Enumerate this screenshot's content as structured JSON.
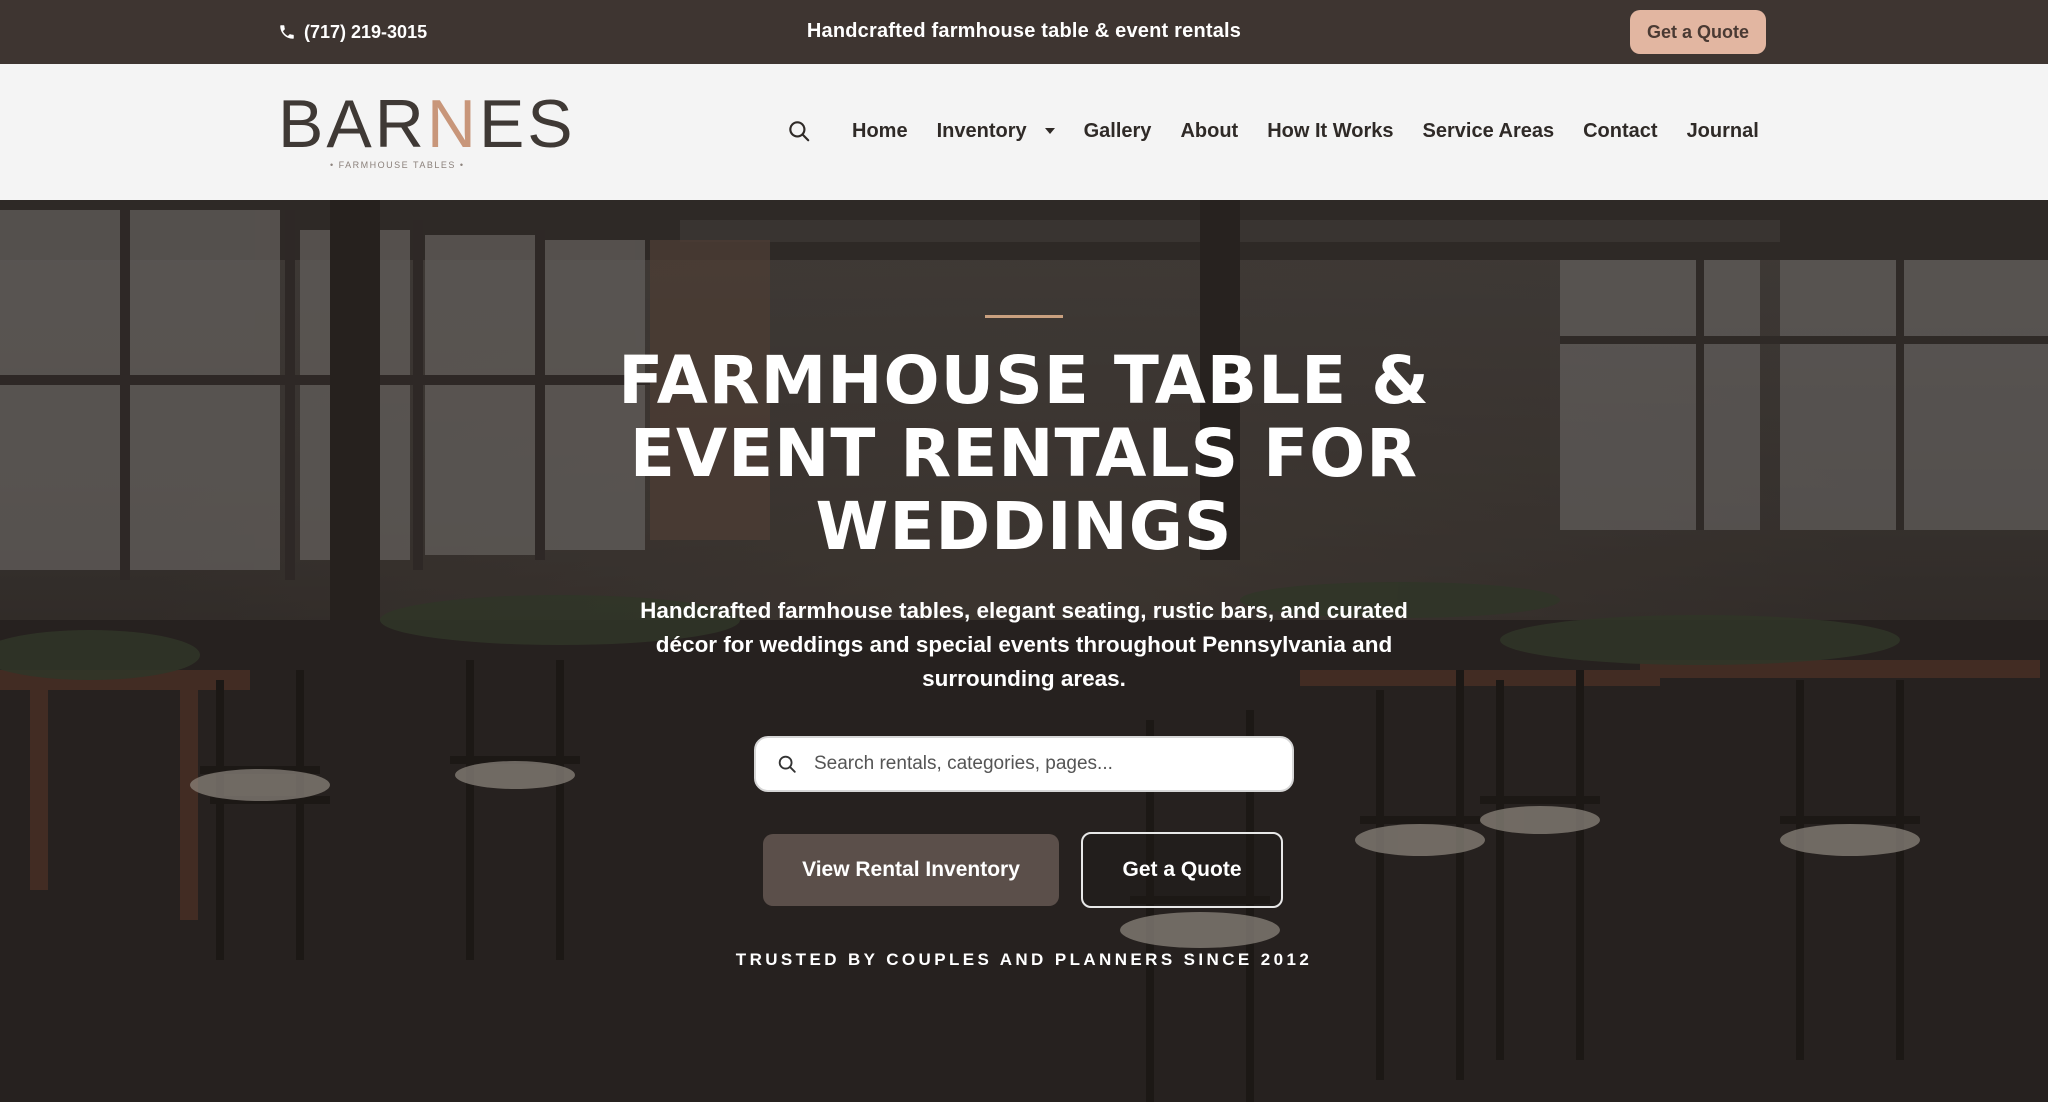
{
  "topbar": {
    "phone": "(717) 219-3015",
    "tagline": "Handcrafted farmhouse table & event rentals",
    "quote_button": "Get a Quote"
  },
  "header": {
    "logo_text": "BARNES",
    "logo_subtitle": "• FARMHOUSE TABLES •",
    "nav": [
      {
        "label": "Home"
      },
      {
        "label": "Inventory",
        "has_dropdown": true
      },
      {
        "label": "Gallery"
      },
      {
        "label": "About"
      },
      {
        "label": "How It Works"
      },
      {
        "label": "Service Areas"
      },
      {
        "label": "Contact"
      },
      {
        "label": "Journal"
      }
    ]
  },
  "hero": {
    "title": "FARMHOUSE TABLE & EVENT RENTALS FOR WEDDINGS",
    "subtitle": "Handcrafted farmhouse tables, elegant seating, rustic bars, and curated décor for weddings and special events throughout Pennsylvania and surrounding areas.",
    "search_placeholder": "Search rentals, categories, pages...",
    "primary_button": "View Rental Inventory",
    "secondary_button": "Get a Quote",
    "trusted_text": "TRUSTED BY COUPLES AND PLANNERS SINCE 2012"
  },
  "colors": {
    "topbar_bg": "#3e3531",
    "header_bg": "#f4f4f4",
    "accent": "#e2b6a1",
    "accent_line": "#c9a07f",
    "primary_button_bg": "#5b4f4a",
    "text_dark": "#2f2a27"
  },
  "icons": {
    "phone": "phone-icon",
    "search": "search-icon",
    "caret": "chevron-down-icon"
  }
}
